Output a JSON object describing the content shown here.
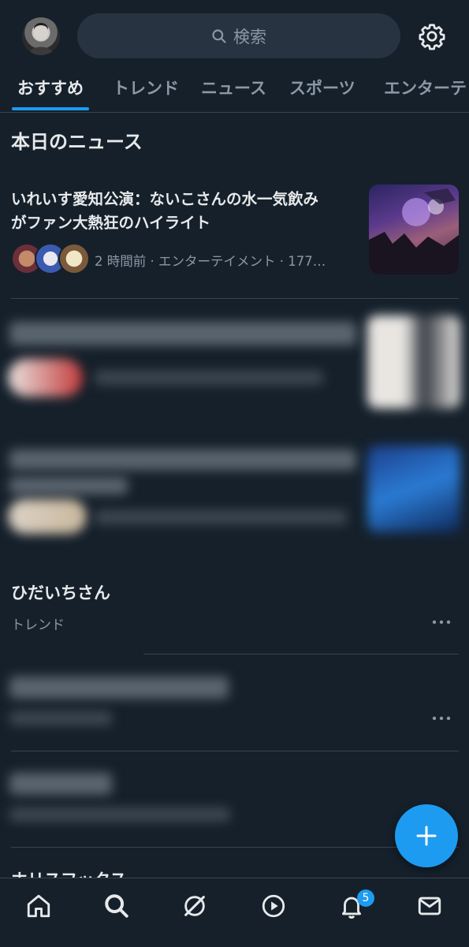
{
  "search": {
    "placeholder": "検索"
  },
  "tabs": [
    {
      "label": "おすすめ",
      "active": true
    },
    {
      "label": "トレンド"
    },
    {
      "label": "ニュース"
    },
    {
      "label": "スポーツ"
    },
    {
      "label": "エンターテ"
    }
  ],
  "section": {
    "title": "本日のニュース"
  },
  "news": [
    {
      "headline_line1": "いれいす愛知公演：ないこさんの水一気飲み",
      "headline_line2": "がファン大熱狂のハイライト",
      "meta": "2 時間前 · エンターテイメント · 177…"
    }
  ],
  "trend": {
    "name": "ひだいちさん",
    "category": "トレンド"
  },
  "partial_section": "ホリスフックス",
  "notifications": {
    "count": "5"
  },
  "colors": {
    "background": "#15202b",
    "accent": "#1d9bf0",
    "muted": "#8b98a5",
    "text": "#e7e9ea"
  }
}
